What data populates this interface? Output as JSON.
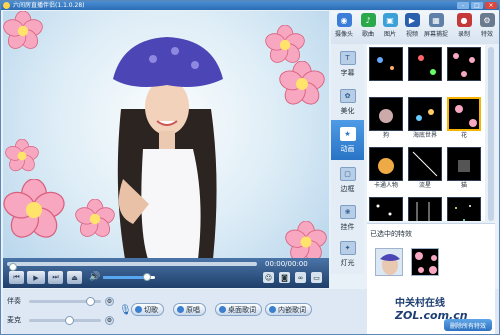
{
  "window": {
    "title": "六间房直播伴侣(1.1.0.28)",
    "min_label": "-",
    "max_label": "□",
    "close_label": "×"
  },
  "player": {
    "time": "00:00/00:00",
    "play_icon": "play-icon",
    "prev_icon": "prev-icon",
    "next_icon": "next-icon",
    "eject_icon": "eject-icon",
    "volume_level": 0.85,
    "seek_position": 0.0
  },
  "bottom": {
    "accompaniment_label": "伴奏",
    "accompaniment_level": 0.85,
    "mic_label": "麦克",
    "mic_level": 0.55,
    "buttons": [
      "切歌",
      "原唱",
      "桌面歌词",
      "内嵌歌词"
    ]
  },
  "top_tabs": [
    {
      "label": "摄像头",
      "icon": "camera-icon",
      "color": "#3b7dd8"
    },
    {
      "label": "歌曲",
      "icon": "music-icon",
      "color": "#2aa84a"
    },
    {
      "label": "图片",
      "icon": "picture-icon",
      "color": "#3aa0d8"
    },
    {
      "label": "视频",
      "icon": "video-icon",
      "color": "#2b5fae"
    },
    {
      "label": "屏幕捕捉",
      "icon": "screen-capture-icon",
      "color": "#5d7fa8"
    },
    {
      "label": "录制",
      "icon": "record-icon",
      "color": "#c43a3a"
    },
    {
      "label": "特效",
      "icon": "effects-icon",
      "color": "#6b7b8f"
    }
  ],
  "side_tabs": [
    {
      "label": "字幕",
      "icon": "caption-icon"
    },
    {
      "label": "美化",
      "icon": "beautify-icon"
    },
    {
      "label": "动画",
      "icon": "animation-icon"
    },
    {
      "label": "边框",
      "icon": "frame-icon"
    },
    {
      "label": "挂件",
      "icon": "pendant-icon"
    },
    {
      "label": "灯光",
      "icon": "light-icon"
    }
  ],
  "effects": [
    "",
    "",
    "",
    "狗",
    "海底世界",
    "花",
    "卡通人物",
    "流星",
    "猫",
    "飘雪",
    "下雨",
    "星空",
    "",
    "",
    ""
  ],
  "selected_effects_label": "已选中的特效",
  "clear_button": "删除所有特效",
  "watermark": {
    "cn": "中关村在线",
    "en": "ZOL.com.cn"
  },
  "colors": {
    "accent": "#2a74c5",
    "flower": "#f7a7c0"
  }
}
